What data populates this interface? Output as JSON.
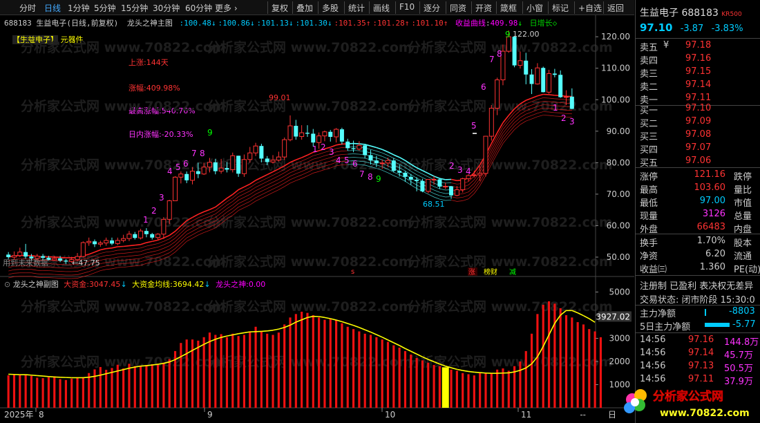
{
  "toolbar": {
    "periods": [
      "分时",
      "日线",
      "1分钟",
      "5分钟",
      "15分钟",
      "30分钟",
      "60分钟",
      "更多 ›"
    ],
    "selected": "日线",
    "tools": [
      "复权",
      "叠加",
      "多股",
      "统计",
      "画线",
      "F10",
      "逐分",
      "同资",
      "开资",
      "箴框",
      "小窗",
      "标记",
      "+自选",
      "返回"
    ]
  },
  "main_header": {
    "code": "688183",
    "name": "生益电子",
    "mode": "(日线,前复权)",
    "indicator": "龙头之神主图",
    "values": [
      "100.48",
      "100.86",
      "101.13",
      "101.30",
      "101.35",
      "101.28",
      "101.10"
    ],
    "value_arrows": [
      "↓",
      "↓",
      "↓",
      "↓",
      "↑",
      "↑",
      "↑"
    ],
    "profit_label": "收益曲线",
    "profit_value": "409.98",
    "profit_arrow": "↓",
    "growth_label": "日增长◇"
  },
  "stock_tag": {
    "name": "【生益电子】",
    "industry": "元器件"
  },
  "stats": {
    "rise_days": "上涨:144天",
    "rise_pct": "涨幅:409.98%",
    "max_rise": "最高涨幅:540.76%",
    "intraday": "日内涨幅:-20.33%"
  },
  "annotations": {
    "low_label": "←47.75",
    "high_label": "122.00",
    "mid_high": "99.01",
    "mid_low": "68.51",
    "future_label": "用到未来数据",
    "badge_s": "s",
    "badge_zhang": "涨",
    "badge_bangcai": "榜财",
    "badge_jian": "减"
  },
  "axis_main": [
    "120.00",
    "110.00",
    "100.00",
    "90.00",
    "80.00",
    "70.00",
    "60.00",
    "50.00"
  ],
  "sub_header": {
    "title": "龙头之神副图",
    "big_money_label": "大资金:",
    "big_money": "3047.45",
    "big_money_arrow": "↓",
    "avg_label": "大资金均线:",
    "avg_value": "3694.42",
    "avg_arrow": "↓",
    "god_label": "龙头之神:",
    "god_value": "0.00"
  },
  "axis_sub": [
    "5000",
    "4000",
    "3000",
    "2000",
    "1000"
  ],
  "axis_sub_current": "3927.02",
  "dates": {
    "year": "2025年",
    "m8": "8",
    "m9": "9",
    "m10": "10",
    "m11": "11"
  },
  "footer_right": [
    "--",
    "日"
  ],
  "quote": {
    "name": "生益电子",
    "code": "688183",
    "badge": "KR500",
    "price": "97.10",
    "change": "-3.87",
    "change_pct": "-3.83%",
    "asks": [
      {
        "label": "卖五",
        "sym": "¥",
        "price": "97.18"
      },
      {
        "label": "卖四",
        "sym": "",
        "price": "97.16"
      },
      {
        "label": "卖三",
        "sym": "",
        "price": "97.15"
      },
      {
        "label": "卖二",
        "sym": "",
        "price": "97.14"
      },
      {
        "label": "卖一",
        "sym": "",
        "price": "97.11"
      }
    ],
    "bids": [
      {
        "label": "买一",
        "price": "97.10"
      },
      {
        "label": "买二",
        "price": "97.09"
      },
      {
        "label": "买三",
        "price": "97.08"
      },
      {
        "label": "买四",
        "price": "97.07"
      },
      {
        "label": "买五",
        "price": "97.06"
      }
    ],
    "info": [
      {
        "l": "涨停",
        "v": "121.16",
        "r": "跌停"
      },
      {
        "l": "最高",
        "v": "103.60",
        "r": "量比"
      },
      {
        "l": "最低",
        "v": "97.00",
        "r": "市值"
      },
      {
        "l": "现量",
        "v": "3126",
        "r": "总量"
      },
      {
        "l": "外盘",
        "v": "66483",
        "r": "内盘"
      }
    ],
    "info2": [
      {
        "l": "换手",
        "v": "1.70%",
        "r": "股本"
      },
      {
        "l": "净资",
        "v": "6.20",
        "r": "流通"
      },
      {
        "l": "收益㈢",
        "v": "1.360",
        "r": "PE(动)"
      }
    ],
    "tags": "注册制 已盈利 表决权无差异",
    "status": "交易状态: 闭市阶段 15:30:0",
    "net_main": {
      "label": "主力净额",
      "value": "-8803"
    },
    "net_5d": {
      "label": "5日主力净额",
      "value": "-5.77"
    },
    "ticks": [
      {
        "t": "14:56",
        "p": "97.16",
        "v": "144.8万"
      },
      {
        "t": "14:56",
        "p": "97.14",
        "v": "45.7万"
      },
      {
        "t": "14:56",
        "p": "97.13",
        "v": "50.5万"
      },
      {
        "t": "14:56",
        "p": "97.11",
        "v": "37.9万"
      }
    ]
  },
  "watermark": "分析家公式网 www.70822.com",
  "logo": {
    "text": "分析家公式网",
    "url": "www.70822.com"
  },
  "chart_data": {
    "type": "candlestick",
    "ylim": [
      47,
      123
    ],
    "candles": [
      [
        50.8,
        50.0,
        51.6,
        49.4
      ],
      [
        50.0,
        50.5,
        51.8,
        49.4
      ],
      [
        50.5,
        51.6,
        53.0,
        50.0
      ],
      [
        51.6,
        50.2,
        54.2,
        49.5
      ],
      [
        50.2,
        49.6,
        51.0,
        48.9
      ],
      [
        49.6,
        50.3,
        51.0,
        49.0
      ],
      [
        50.3,
        49.8,
        51.0,
        49.1
      ],
      [
        49.8,
        49.1,
        50.4,
        48.9
      ],
      [
        49.1,
        49.6,
        50.4,
        48.8
      ],
      [
        49.6,
        48.9,
        50.4,
        48.4
      ],
      [
        48.9,
        48.6,
        49.4,
        47.75
      ],
      [
        48.6,
        49.2,
        50.1,
        48.2
      ],
      [
        49.2,
        50.2,
        51.3,
        48.8
      ],
      [
        50.2,
        54.6,
        55.0,
        49.9
      ],
      [
        54.6,
        55.0,
        56.2,
        53.6
      ],
      [
        55.0,
        54.1,
        55.6,
        53.2
      ],
      [
        54.1,
        54.5,
        55.2,
        53.3
      ],
      [
        54.5,
        55.3,
        56.2,
        53.6
      ],
      [
        55.3,
        54.3,
        56.2,
        53.8
      ],
      [
        54.3,
        55.3,
        56.2,
        53.8
      ],
      [
        55.3,
        55.9,
        57.1,
        54.7
      ],
      [
        55.9,
        57.3,
        58.3,
        55.1
      ],
      [
        57.3,
        56.1,
        58.0,
        55.6
      ],
      [
        56.1,
        58.3,
        59.0,
        55.6
      ],
      [
        58.3,
        57.3,
        59.2,
        56.3
      ],
      [
        57.3,
        56.2,
        57.7,
        55.6
      ],
      [
        56.2,
        57.3,
        57.6,
        55.6
      ],
      [
        57.3,
        62.0,
        62.7,
        55.8
      ],
      [
        62.0,
        67.9,
        68.2,
        60.5
      ],
      [
        67.9,
        75.4,
        75.7,
        67.9
      ],
      [
        75.4,
        76.4,
        77.2,
        73.4
      ],
      [
        76.4,
        74.4,
        77.2,
        73.5
      ],
      [
        74.4,
        77.3,
        78.6,
        73.1
      ],
      [
        77.3,
        76.4,
        80.0,
        75.1
      ],
      [
        76.4,
        78.6,
        80.0,
        76.1
      ],
      [
        78.6,
        80.1,
        81.5,
        76.9
      ],
      [
        80.1,
        77.3,
        81.2,
        76.3
      ],
      [
        77.3,
        78.3,
        81.2,
        76.5
      ],
      [
        78.3,
        77.8,
        80.2,
        76.9
      ],
      [
        77.8,
        82.2,
        83.2,
        76.9
      ],
      [
        82.2,
        76.5,
        82.2,
        75.5
      ],
      [
        76.5,
        81.0,
        82.6,
        75.5
      ],
      [
        81.0,
        83.1,
        85.0,
        80.0
      ],
      [
        83.1,
        85.3,
        86.3,
        82.1
      ],
      [
        85.3,
        81.3,
        86.0,
        80.1
      ],
      [
        81.3,
        80.2,
        82.1,
        79.2
      ],
      [
        80.2,
        80.8,
        82.4,
        79.7
      ],
      [
        80.8,
        81.8,
        83.5,
        80.4
      ],
      [
        81.8,
        87.3,
        88.0,
        80.9
      ],
      [
        87.3,
        91.7,
        95.0,
        86.8
      ],
      [
        91.7,
        88.3,
        93.6,
        87.3
      ],
      [
        88.3,
        89.5,
        91.9,
        87.3
      ],
      [
        89.5,
        89.2,
        91.9,
        88.2
      ],
      [
        89.2,
        86.4,
        90.7,
        85.1
      ],
      [
        86.4,
        88.5,
        89.6,
        84.4
      ],
      [
        88.5,
        89.8,
        90.2,
        86.8
      ],
      [
        89.8,
        88.2,
        90.4,
        86.7
      ],
      [
        88.2,
        90.6,
        91.0,
        86.4
      ],
      [
        90.6,
        86.7,
        91.1,
        85.8
      ],
      [
        86.7,
        84.6,
        87.6,
        83.8
      ],
      [
        84.6,
        84.3,
        87.0,
        83.3
      ],
      [
        84.3,
        85.5,
        86.8,
        83.8
      ],
      [
        85.5,
        82.4,
        86.0,
        81.4
      ],
      [
        82.4,
        80.7,
        84.1,
        79.4
      ],
      [
        80.7,
        79.8,
        82.2,
        78.6
      ],
      [
        79.8,
        79.9,
        81.0,
        78.0
      ],
      [
        79.9,
        80.7,
        81.6,
        78.6
      ],
      [
        80.7,
        77.4,
        81.5,
        76.9
      ],
      [
        77.4,
        76.8,
        79.3,
        75.6
      ],
      [
        76.8,
        75.5,
        77.3,
        73.9
      ],
      [
        75.5,
        74.6,
        76.4,
        73.0
      ],
      [
        74.6,
        74.2,
        75.4,
        70.9
      ],
      [
        74.2,
        70.9,
        74.9,
        70.6
      ],
      [
        70.9,
        74.7,
        74.7,
        70.3
      ],
      [
        74.7,
        74.7,
        75.7,
        73.0
      ],
      [
        74.7,
        72.4,
        75.0,
        71.6
      ],
      [
        72.4,
        72.5,
        73.7,
        71.6
      ],
      [
        72.5,
        69.6,
        72.6,
        68.51
      ],
      [
        69.6,
        71.4,
        72.6,
        69.3
      ],
      [
        71.4,
        74.9,
        75.2,
        70.5
      ],
      [
        74.9,
        75.9,
        76.3,
        74.0
      ],
      [
        75.9,
        76.1,
        77.4,
        75.3
      ],
      [
        76.1,
        76.6,
        78.8,
        74.2
      ],
      [
        76.6,
        88.4,
        88.5,
        75.6
      ],
      [
        88.4,
        97.3,
        98.3,
        87.0
      ],
      [
        97.3,
        106.3,
        107.0,
        95.1
      ],
      [
        106.3,
        115.4,
        117.5,
        104.6
      ],
      [
        115.4,
        120.0,
        122.0,
        114.9
      ],
      [
        120.0,
        110.9,
        120.2,
        110.3
      ],
      [
        110.9,
        112.4,
        115.3,
        109.9
      ],
      [
        112.4,
        108.0,
        114.9,
        104.9
      ],
      [
        108.0,
        105.0,
        109.7,
        101.8
      ],
      [
        105.0,
        110.1,
        111.6,
        104.8
      ],
      [
        110.1,
        102.4,
        110.5,
        102.3
      ],
      [
        102.4,
        108.3,
        109.5,
        101.9
      ],
      [
        108.3,
        107.9,
        109.8,
        107.1
      ],
      [
        107.9,
        100.8,
        109.3,
        100.6
      ],
      [
        100.8,
        100.97,
        103.0,
        98.3
      ],
      [
        100.97,
        97.1,
        103.6,
        97.0
      ]
    ],
    "line_value": [
      50.0,
      50.4,
      50.5,
      50.5,
      50.5,
      50.2,
      50.1,
      50.1,
      50.0,
      49.9,
      49.8,
      49.8,
      49.9,
      50.4,
      50.9,
      51.6,
      52.3,
      52.7,
      52.9,
      53.3,
      53.4,
      53.6,
      53.8,
      54.0,
      54.6,
      55.0,
      55.4,
      56.1,
      56.9,
      58.2,
      59.9,
      61.6,
      62.6,
      63.6,
      64.4,
      65.1,
      65.9,
      67.3,
      68.7,
      69.9,
      71.4,
      72.3,
      73.2,
      74.4,
      75.3,
      76.2,
      77.1,
      78.0,
      79.0,
      80.1,
      80.9,
      81.6,
      82.4,
      83.3,
      83.8,
      84.4,
      84.9,
      85.6,
      85.9,
      86.0,
      86.1,
      86.0,
      85.8,
      85.3,
      84.8,
      84.2,
      83.4,
      82.5,
      81.7,
      80.7,
      79.5,
      78.4,
      77.5,
      76.6,
      75.7,
      75.0,
      74.6,
      74.7,
      74.3,
      74.5,
      75.1,
      76.8,
      79.3,
      82.5,
      86.1,
      89.5,
      92.7,
      95.0,
      97.1,
      98.7,
      99.8,
      100.5,
      101.2,
      101.7,
      101.6,
      101.4,
      101.3,
      101.1,
      101.0
    ],
    "ribbon_color": [
      "r",
      "r",
      "r",
      "r",
      "r",
      "r",
      "r",
      "r",
      "r",
      "r",
      "r",
      "r",
      "r",
      "r",
      "r",
      "r",
      "r",
      "r",
      "r",
      "r",
      "r",
      "r",
      "r",
      "r",
      "r",
      "r",
      "r",
      "r",
      "r",
      "r",
      "r",
      "r",
      "r",
      "r",
      "r",
      "r",
      "r",
      "r",
      "r",
      "r",
      "r",
      "r",
      "r",
      "r",
      "r",
      "r",
      "r",
      "r",
      "r",
      "r",
      "r",
      "r",
      "r",
      "r",
      "r",
      "r",
      "r",
      "r",
      "r",
      "c",
      "c",
      "c",
      "c",
      "c",
      "c",
      "c",
      "c",
      "c",
      "c",
      "c",
      "c",
      "c",
      "c",
      "c",
      "c",
      "c",
      "c",
      "r",
      "r",
      "r",
      "r",
      "r",
      "r",
      "r",
      "r",
      "r",
      "r",
      "r",
      "r",
      "r",
      "r",
      "r",
      "r",
      "r",
      "r",
      "r",
      "r",
      "r",
      "r",
      "r"
    ],
    "sub_values": [
      1400,
      1420,
      1410,
      1430,
      1380,
      1300,
      1280,
      1320,
      1360,
      1240,
      1200,
      1260,
      1300,
      1320,
      1500,
      1660,
      1760,
      1640,
      1720,
      1860,
      1700,
      1900,
      1800,
      1820,
      1850,
      1880,
      1900,
      1950,
      2100,
      2450,
      2800,
      2950,
      2950,
      2900,
      3050,
      3250,
      3150,
      3180,
      3050,
      3200,
      3100,
      3150,
      3300,
      3500,
      3300,
      3200,
      3150,
      3250,
      3600,
      3900,
      4050,
      4150,
      4100,
      4000,
      3900,
      3800,
      3850,
      3800,
      3650,
      3500,
      3400,
      3300,
      3200,
      3150,
      3050,
      2950,
      2850,
      2700,
      2600,
      2450,
      2300,
      2150,
      2050,
      1950,
      1850,
      1800,
      1750,
      1650,
      1600,
      1500,
      1450,
      1400,
      1500,
      1500,
      1500,
      1650,
      1700,
      1600,
      1800,
      2000,
      2450,
      3200,
      4050,
      4450,
      4600,
      4500,
      4300,
      4000,
      3900,
      3700,
      3600,
      3400,
      3300,
      3047
    ],
    "sub_avg": [
      1450,
      1440,
      1430,
      1430,
      1410,
      1390,
      1370,
      1350,
      1330,
      1320,
      1310,
      1300,
      1300,
      1300,
      1320,
      1360,
      1410,
      1470,
      1530,
      1590,
      1650,
      1710,
      1760,
      1800,
      1820,
      1850,
      1880,
      1920,
      1980,
      2080,
      2210,
      2340,
      2480,
      2610,
      2740,
      2860,
      2960,
      3040,
      3100,
      3150,
      3200,
      3240,
      3280,
      3290,
      3300,
      3320,
      3350,
      3400,
      3470,
      3570,
      3700,
      3800,
      3900,
      3950,
      3940,
      3900,
      3850,
      3790,
      3720,
      3640,
      3560,
      3470,
      3370,
      3270,
      3160,
      3050,
      2930,
      2810,
      2690,
      2560,
      2440,
      2320,
      2200,
      2090,
      1990,
      1890,
      1800,
      1730,
      1660,
      1610,
      1570,
      1540,
      1520,
      1500,
      1490,
      1490,
      1500,
      1510,
      1550,
      1620,
      1720,
      1900,
      2200,
      2650,
      3150,
      3650,
      4000,
      4200,
      4200,
      4100,
      3980,
      3850,
      3694
    ]
  }
}
